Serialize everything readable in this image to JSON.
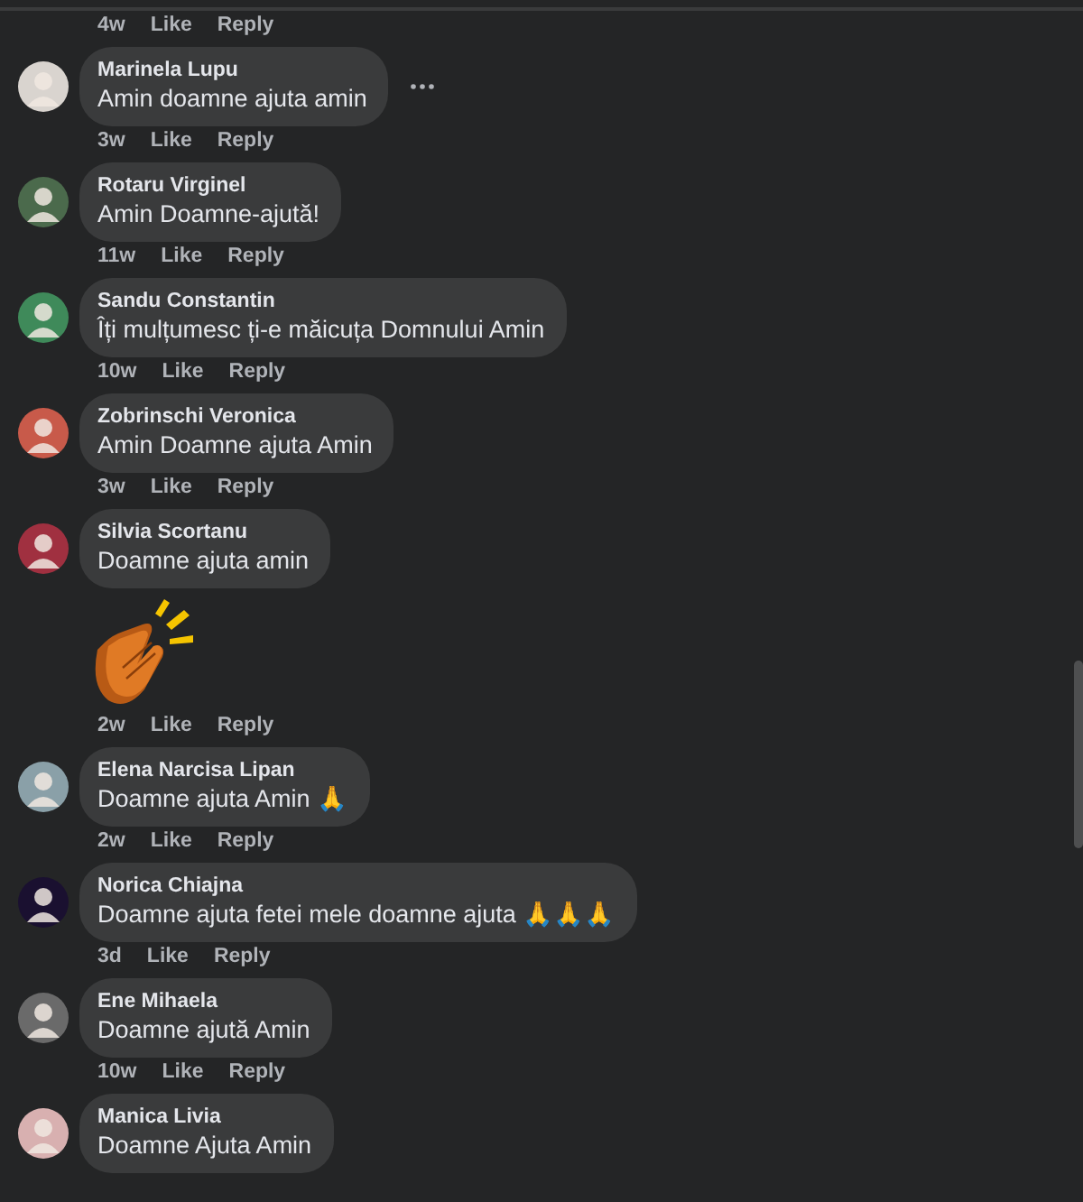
{
  "top_meta": {
    "time": "4w",
    "like": "Like",
    "reply": "Reply"
  },
  "comments": [
    {
      "name": "Marinela Lupu",
      "text": "Amin doamne ajuta amin",
      "time": "3w",
      "like": "Like",
      "reply": "Reply",
      "sticker": false,
      "options_shown": true
    },
    {
      "name": "Rotaru Virginel",
      "text": "Amin Doamne-ajută!",
      "time": "11w",
      "like": "Like",
      "reply": "Reply",
      "sticker": false,
      "options_shown": false
    },
    {
      "name": "Sandu Constantin",
      "text": "Îți mulțumesc ți-e măicuța Domnului Amin",
      "time": "10w",
      "like": "Like",
      "reply": "Reply",
      "sticker": false,
      "options_shown": false
    },
    {
      "name": "Zobrinschi Veronica",
      "text": "Amin Doamne ajuta Amin",
      "time": "3w",
      "like": "Like",
      "reply": "Reply",
      "sticker": false,
      "options_shown": false
    },
    {
      "name": "Silvia Scortanu",
      "text": "Doamne ajuta amin",
      "time": "2w",
      "like": "Like",
      "reply": "Reply",
      "sticker": true,
      "options_shown": false
    },
    {
      "name": "Elena Narcisa Lipan",
      "text": "Doamne ajuta Amin 🙏",
      "time": "2w",
      "like": "Like",
      "reply": "Reply",
      "sticker": false,
      "options_shown": false
    },
    {
      "name": "Norica Chiajna",
      "text": "Doamne ajuta fetei mele doamne ajuta 🙏🙏🙏",
      "time": "3d",
      "like": "Like",
      "reply": "Reply",
      "sticker": false,
      "options_shown": false
    },
    {
      "name": "Ene Mihaela",
      "text": "Doamne ajută Amin",
      "time": "10w",
      "like": "Like",
      "reply": "Reply",
      "sticker": false,
      "options_shown": false
    },
    {
      "name": "Manica Livia",
      "text": "Doamne Ajuta Amin",
      "sticker": false,
      "options_shown": false
    }
  ]
}
